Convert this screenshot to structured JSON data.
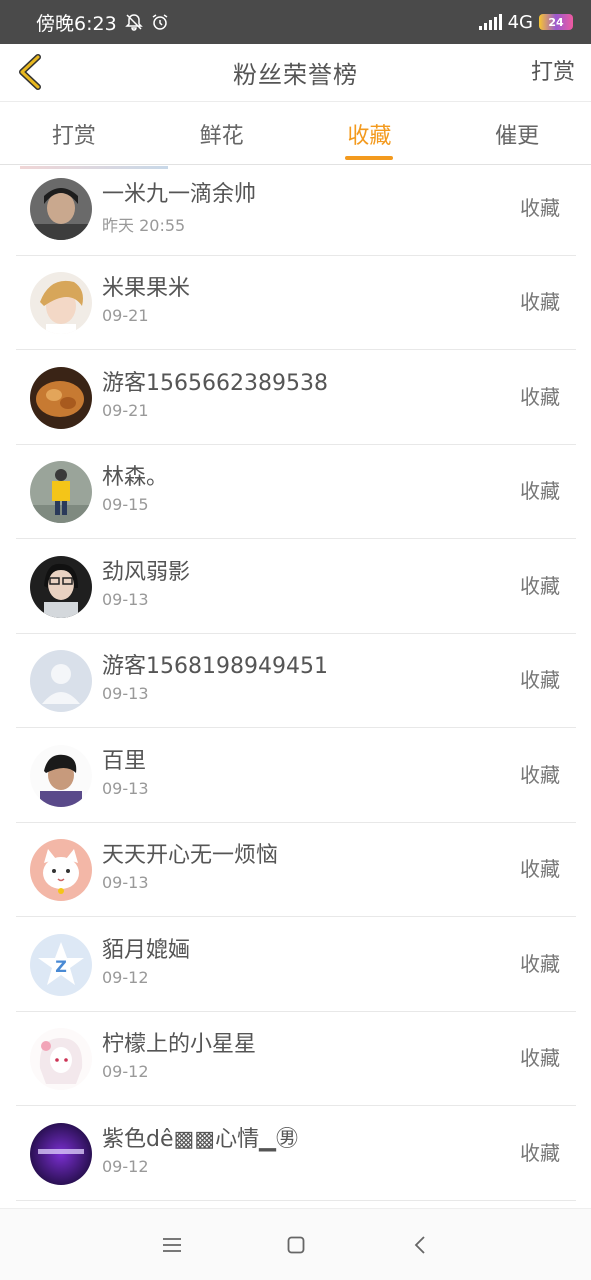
{
  "status_bar": {
    "time": "傍晚6:23",
    "network": "4G",
    "battery": "24"
  },
  "nav": {
    "title": "粉丝荣誉榜",
    "action": "打赏"
  },
  "tabs": [
    {
      "label": "打赏"
    },
    {
      "label": "鲜花"
    },
    {
      "label": "收藏",
      "active": true
    },
    {
      "label": "催更"
    }
  ],
  "colors": {
    "accent": "#f39a1e",
    "back_arrow": "#e8b820"
  },
  "rows": [
    {
      "name": "一米九一滴余帅",
      "time": "昨天 20:55",
      "tag": "收藏",
      "avatar": "photo-dark"
    },
    {
      "name": "米果果米",
      "time": "09-21",
      "tag": "收藏",
      "avatar": "photo-blond"
    },
    {
      "name": "游客1565662389538",
      "time": "09-21",
      "tag": "收藏",
      "avatar": "photo-croissant"
    },
    {
      "name": "林森。",
      "time": "09-15",
      "tag": "收藏",
      "avatar": "photo-yellow"
    },
    {
      "name": "劲风弱影",
      "time": "09-13",
      "tag": "收藏",
      "avatar": "photo-glasses"
    },
    {
      "name": "游客1568198949451",
      "time": "09-13",
      "tag": "收藏",
      "avatar": "default-user"
    },
    {
      "name": "百里",
      "time": "09-13",
      "tag": "收藏",
      "avatar": "photo-boy"
    },
    {
      "name": "天天开心无一烦恼",
      "time": "09-13",
      "tag": "收藏",
      "avatar": "cat"
    },
    {
      "name": "貊月媲婳",
      "time": "09-12",
      "tag": "收藏",
      "avatar": "qq-logo"
    },
    {
      "name": "柠檬上的小星星",
      "time": "09-12",
      "tag": "收藏",
      "avatar": "anime-girl"
    },
    {
      "name": "紫色dê▩▩心情▁㊚",
      "time": "09-12",
      "tag": "收藏",
      "avatar": "purple"
    }
  ]
}
